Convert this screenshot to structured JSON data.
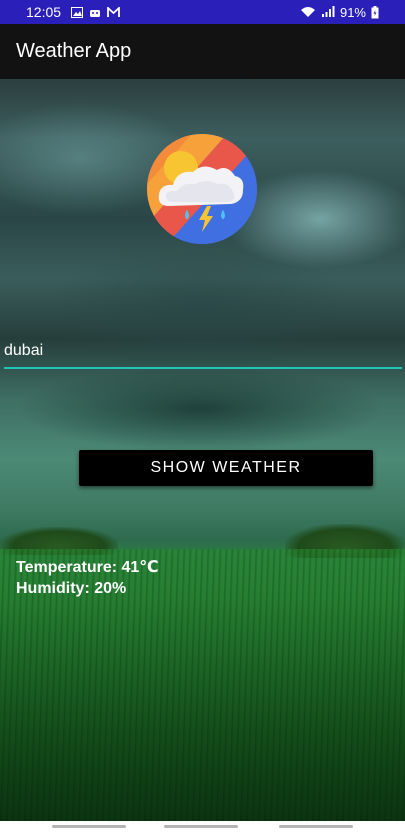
{
  "status_bar": {
    "time": "12:05",
    "battery": "91%",
    "color": "#2a1fb8"
  },
  "app_bar": {
    "title": "Weather App"
  },
  "logo": {
    "icon": "weather-storm-icon"
  },
  "city_input": {
    "value": "dubai",
    "underline_color": "#1fc6b8"
  },
  "button": {
    "label": "SHOW WEATHER"
  },
  "result": {
    "temperature": "Temperature: 41℃",
    "humidity": "Humidity: 20%"
  }
}
